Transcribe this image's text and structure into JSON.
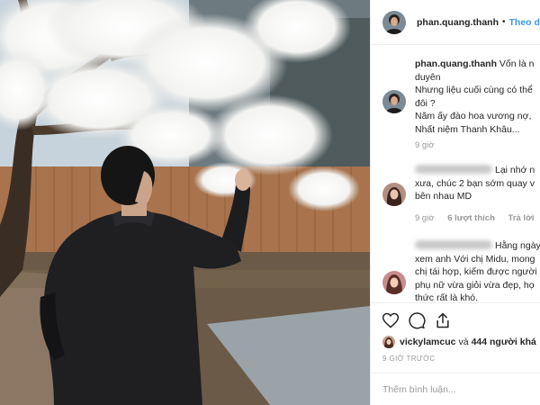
{
  "header": {
    "username": "phan.quang.thanh",
    "separator": "•",
    "follow_label": "Theo dõi"
  },
  "comments": [
    {
      "username": "phan.quang.thanh",
      "lines": [
        "Vốn là n",
        "duyên",
        "Nhưng liệu cuối cùng có thể",
        "đôi ?",
        "Năm ấy đào hoa vương nợ,",
        "Nhất niệm Thanh Khâu..."
      ],
      "time": "9 giờ"
    },
    {
      "lines": [
        "Lại nhớ n",
        "xưa, chúc 2 bạn sớm quay v",
        "bên nhau MD"
      ],
      "time": "9 giờ",
      "likes": "6 lượt thích",
      "reply": "Trả lời"
    },
    {
      "lines": [
        "Hằng ngày vẫn",
        "xem anh Với chị Midu, mong",
        "chị tái hợp, kiếm được người",
        "phụ nữ vừa giỏi vừa đẹp, họ",
        "thức rất là khó."
      ]
    }
  ],
  "actions": {
    "like_icon": "heart-icon",
    "comment_icon": "comment-icon",
    "share_icon": "share-icon"
  },
  "likes_summary": {
    "user": "vickylamcuc",
    "conjunction": "và",
    "others": "444 người khá"
  },
  "post_time": "9 GIỜ TRƯỚC",
  "add_comment_placeholder": "Thêm bình luận..."
}
